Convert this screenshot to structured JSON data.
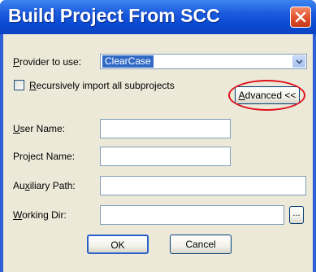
{
  "window": {
    "title": "Build Project From SCC"
  },
  "provider": {
    "label_mnemonic": "P",
    "label_rest": "rovider to use:",
    "value": "ClearCase"
  },
  "recursive": {
    "label_mnemonic": "R",
    "label_rest": "ecursively import all subprojects",
    "checked": false
  },
  "advanced": {
    "label_mnemonic": "A",
    "label_rest": "dvanced <<",
    "highlight_color": "#e0111d"
  },
  "fields": {
    "username": {
      "label_pre": "",
      "label_mnemonic": "U",
      "label_rest": "ser Name:",
      "value": ""
    },
    "project": {
      "label_pre": "Pro",
      "label_mnemonic": "j",
      "label_rest": "ect Name:",
      "value": ""
    },
    "aux": {
      "label_pre": "Au",
      "label_mnemonic": "x",
      "label_rest": "iliary Path:",
      "value": ""
    },
    "workdir": {
      "label_pre": "",
      "label_mnemonic": "W",
      "label_rest": "orking Dir:",
      "value": ""
    }
  },
  "buttons": {
    "ok": "OK",
    "cancel": "Cancel",
    "browse": "..."
  },
  "icons": {
    "close": "close-icon",
    "dropdown": "chevron-down-icon"
  },
  "colors": {
    "titlebar": "#0a4ad2",
    "close_button": "#e1502d",
    "dialog_face": "#ece9d8",
    "selection": "#316ac5"
  }
}
